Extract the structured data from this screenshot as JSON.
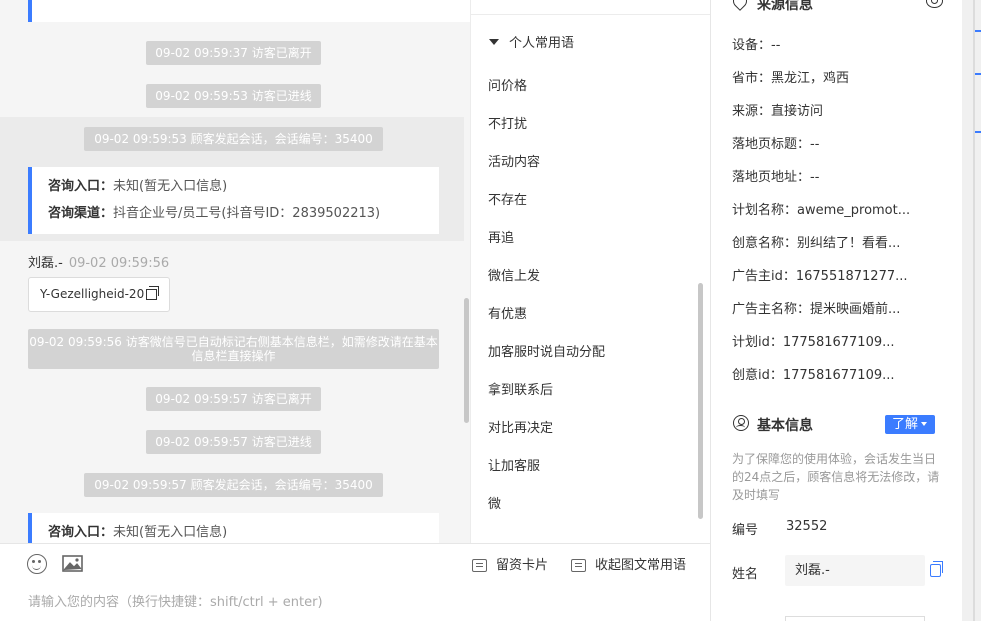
{
  "chat": {
    "messages": [
      {
        "text": "09-02 09:59:37 访客已离开"
      },
      {
        "text": "09-02 09:59:53 访客已进线"
      },
      {
        "text": "09-02 09:59:53 顾客发起会话，会话编号：35400"
      },
      {
        "text": "09-02 09:59:57 访客已离开"
      },
      {
        "text": "09-02 09:59:57 访客已进线"
      },
      {
        "text": "09-02 09:59:57 顾客发起会话，会话编号：35400"
      }
    ],
    "info_card_1": {
      "entry_label": "咨询入口：",
      "entry_value": "未知(暂无入口信息)",
      "channel_label": "咨询渠道：",
      "channel_value": "抖音企业号/员工号(抖音号ID：2839502213)"
    },
    "info_card_2": {
      "entry_label": "咨询入口：",
      "entry_value": "未知(暂无入口信息)"
    },
    "sender_name": "刘磊.-",
    "sender_time": "09-02 09:59:56",
    "bubble_text": "Y-Gezelligheid-20",
    "wide_notice": "09-02 09:59:56 访客微信号已自动标记右侧基本信息栏，如需修改请在基本信息栏直接操作"
  },
  "composer": {
    "placeholder": "请输入您的内容（换行快捷键：shift/ctrl + enter)",
    "tool_lead_card": "留资卡片",
    "tool_collapse": "收起图文常用语"
  },
  "quick_replies": {
    "header": "个人常用语",
    "items": [
      "问价格",
      "不打扰",
      "活动内容",
      "不存在",
      "再追",
      "微信上发",
      "有优惠",
      "加客服时说自动分配",
      "拿到联系后",
      "对比再决定",
      "让加客服",
      "微"
    ]
  },
  "source_info": {
    "title": "来源信息",
    "rows": [
      "设备：--",
      "省市：黑龙江，鸡西",
      "来源：直接访问",
      "落地页标题：--",
      "落地页地址：--",
      "计划名称：aweme_promot...",
      "创意名称：别纠结了！看看...",
      "广告主id：167551871277...",
      "广告主名称：提米映画婚前...",
      "计划id：177581677109...",
      "创意id：177581677109..."
    ]
  },
  "basic_info": {
    "title": "基本信息",
    "learn_button": "了解",
    "notice": "为了保障您的使用体验，会话发生当日的24点之后，顾客信息将无法修改，请及时填写",
    "id_label": "编号",
    "id_value": "32552",
    "name_label": "姓名",
    "name_value": "刘磊.-"
  },
  "colors": {
    "accent": "#3b7cff",
    "system_bubble": "#d3d3d3",
    "chat_bg": "#f5f5f5"
  }
}
